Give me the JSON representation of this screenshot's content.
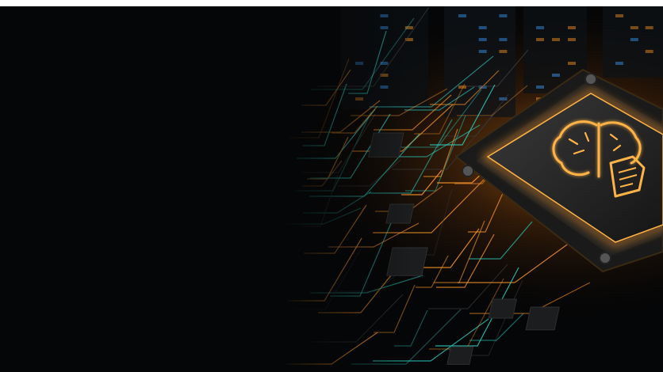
{
  "scene": {
    "subject": "glowing-ai-processor-chip",
    "icons": [
      "brain-icon",
      "document-icon"
    ],
    "colors": {
      "background": "#050607",
      "glow_orange": "#ff9a2a",
      "glow_amber": "#ffb347",
      "trace_teal": "#2fd3c6",
      "chip_body": "#2a2a2a",
      "server_blue": "#3aa0ff"
    }
  }
}
